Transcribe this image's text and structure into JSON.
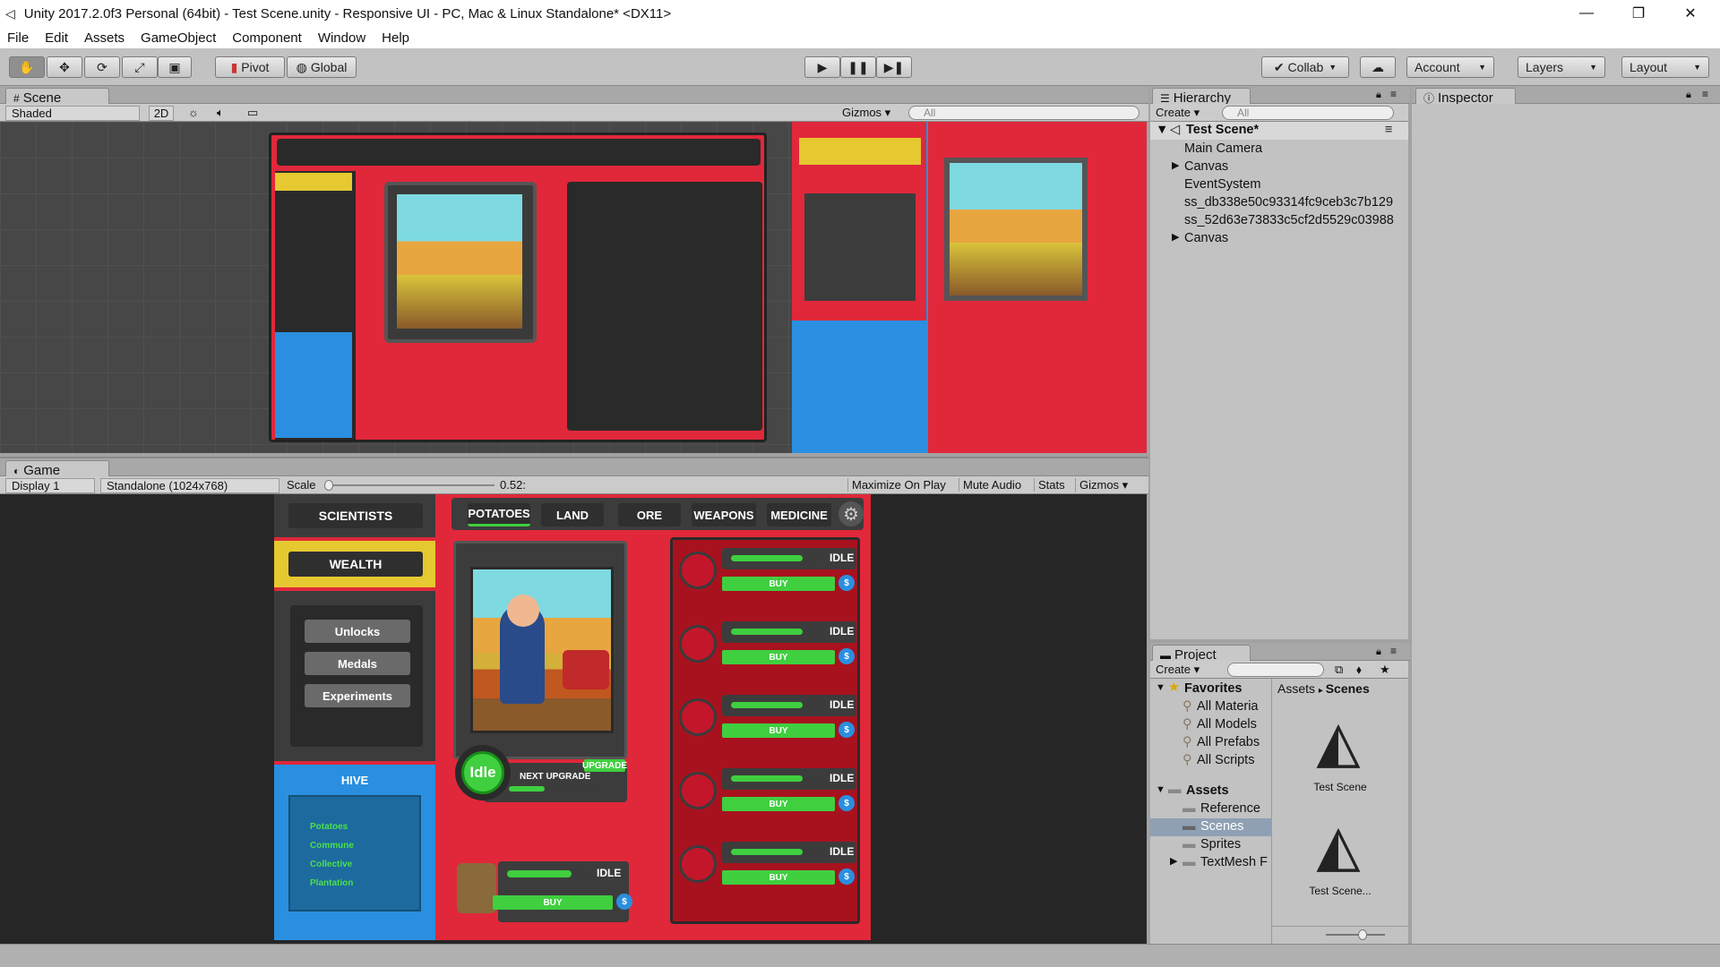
{
  "window": {
    "title": "Unity 2017.2.0f3 Personal (64bit) - Test Scene.unity - Responsive UI - PC, Mac & Linux Standalone* <DX11>"
  },
  "menu": [
    "File",
    "Edit",
    "Assets",
    "GameObject",
    "Component",
    "Window",
    "Help"
  ],
  "toolbar": {
    "pivot": "Pivot",
    "global": "Global",
    "collab": "Collab",
    "account": "Account",
    "layers": "Layers",
    "layout": "Layout"
  },
  "scene": {
    "tab": "Scene",
    "shading": "Shaded",
    "mode2d": "2D",
    "gizmos": "Gizmos",
    "search_placeholder": "All"
  },
  "game": {
    "tab": "Game",
    "display": "Display 1",
    "resolution": "Standalone (1024x768)",
    "scale_label": "Scale",
    "scale_value": "0.52:",
    "maximize": "Maximize On Play",
    "mute": "Mute Audio",
    "stats": "Stats",
    "gizmos": "Gizmos",
    "top_tabs": [
      "POTATOES",
      "LAND",
      "ORE",
      "WEAPONS",
      "MEDICINE"
    ],
    "scientists": "SCIENTISTS",
    "wealth": "WEALTH",
    "menu_buttons": [
      "Unlocks",
      "Medals",
      "Experiments"
    ],
    "hive_title": "HIVE",
    "hive_items": [
      "Potatoes",
      "Commune",
      "Collective",
      "Plantation"
    ],
    "idle_button": "Idle",
    "upgrade": "UPGRADE",
    "next_upgrade": "NEXT UPGRADE",
    "row_status": "IDLE",
    "row_buy": "BUY"
  },
  "hierarchy": {
    "tab": "Hierarchy",
    "create": "Create",
    "search_placeholder": "All",
    "scene_name": "Test Scene*",
    "items": [
      "Main Camera",
      "Canvas",
      "EventSystem",
      "ss_db338e50c93314fc9ceb3c7b129",
      "ss_52d63e73833c5cf2d5529c03988",
      "Canvas"
    ]
  },
  "inspector": {
    "tab": "Inspector"
  },
  "project": {
    "tab": "Project",
    "create": "Create",
    "favorites_label": "Favorites",
    "favorites": [
      "All Materia",
      "All Models",
      "All Prefabs",
      "All Scripts"
    ],
    "assets_label": "Assets",
    "assets_folders": [
      "Reference",
      "Scenes",
      "Sprites",
      "TextMesh F"
    ],
    "breadcrumb": [
      "Assets",
      "Scenes"
    ],
    "files": [
      "Test Scene",
      "Test Scene..."
    ]
  }
}
